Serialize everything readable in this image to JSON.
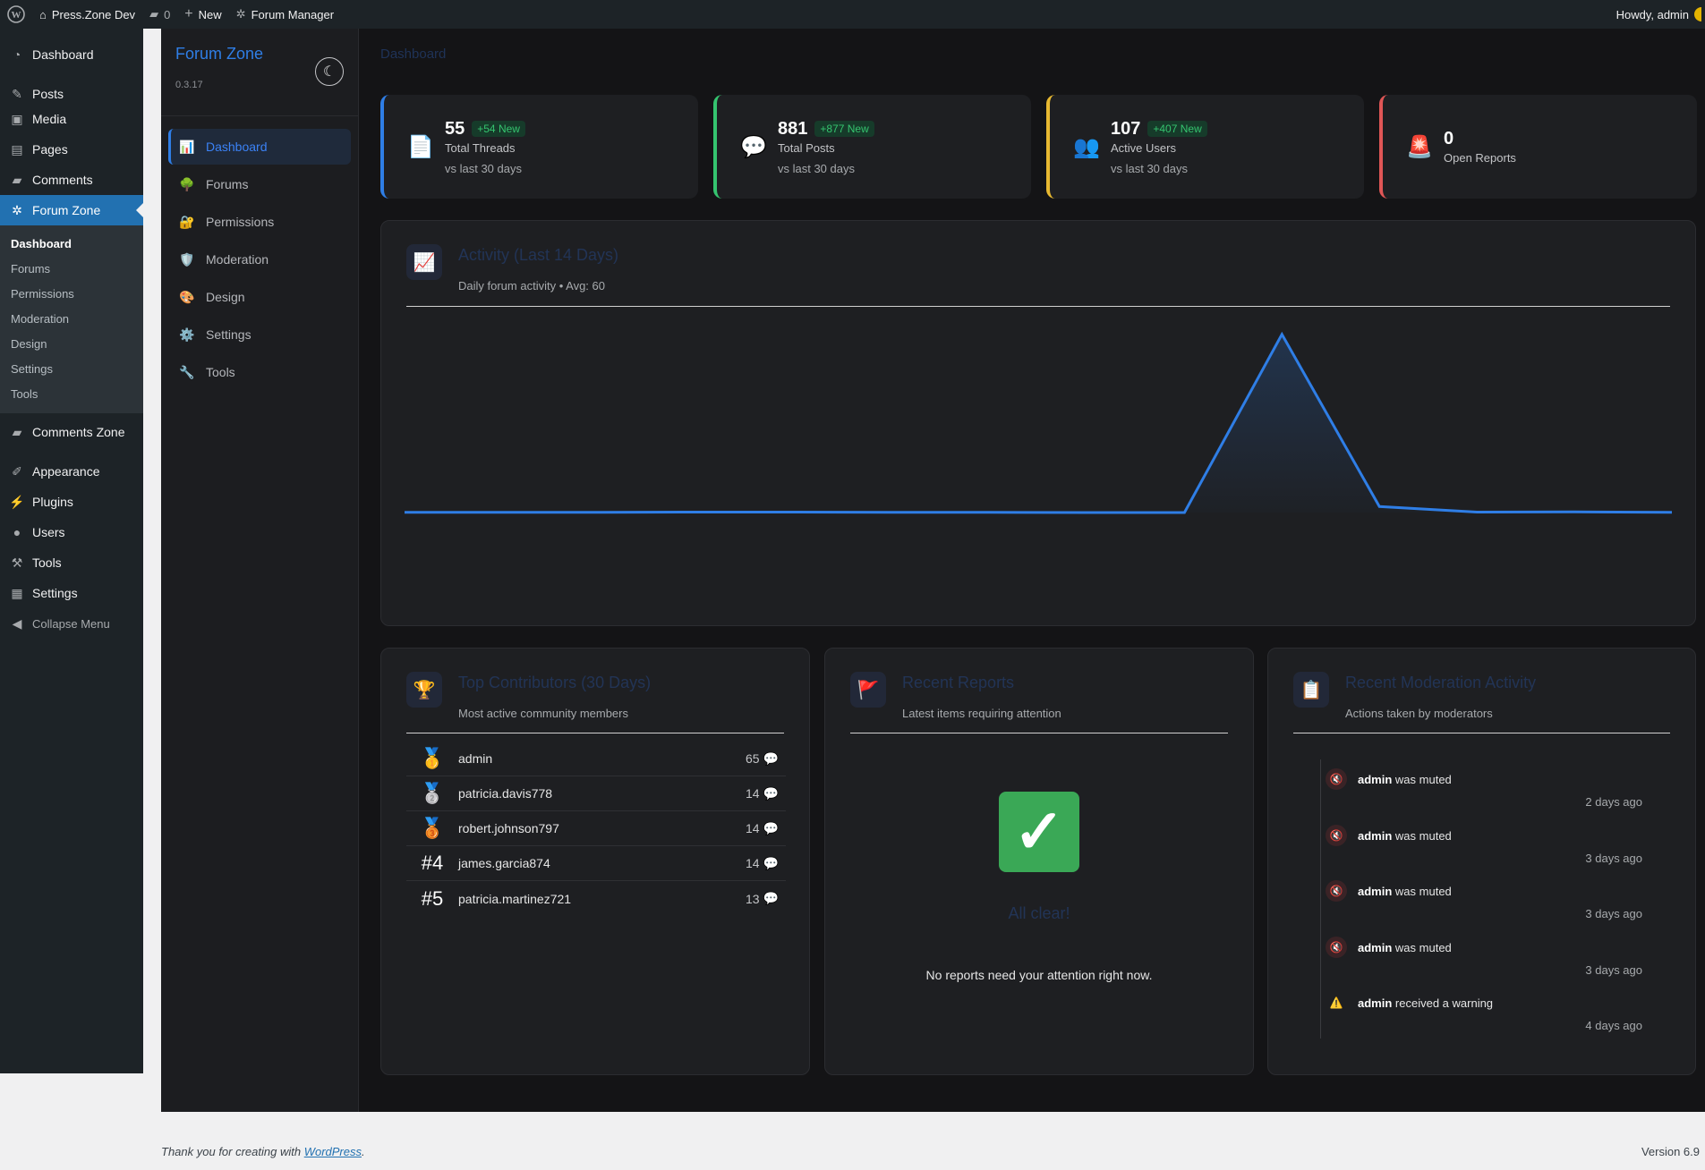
{
  "adminbar": {
    "site_name": "Press.Zone Dev",
    "comments_count": "0",
    "new_label": "New",
    "forum_manager_label": "Forum Manager",
    "howdy": "Howdy, admin"
  },
  "wp_menu": {
    "dashboard": "Dashboard",
    "posts": "Posts",
    "media": "Media",
    "pages": "Pages",
    "comments": "Comments",
    "forum_zone": "Forum Zone",
    "submenu": [
      "Dashboard",
      "Forums",
      "Permissions",
      "Moderation",
      "Design",
      "Settings",
      "Tools"
    ],
    "comments_zone": "Comments Zone",
    "appearance": "Appearance",
    "plugins": "Plugins",
    "users": "Users",
    "tools": "Tools",
    "settings": "Settings",
    "collapse": "Collapse Menu"
  },
  "plugin": {
    "title": "Forum Zone",
    "version": "0.3.17",
    "nav": [
      {
        "label": "Dashboard",
        "icon": "📊"
      },
      {
        "label": "Forums",
        "icon": "🌳"
      },
      {
        "label": "Permissions",
        "icon": "🔐"
      },
      {
        "label": "Moderation",
        "icon": "🛡️"
      },
      {
        "label": "Design",
        "icon": "🎨"
      },
      {
        "label": "Settings",
        "icon": "⚙️"
      },
      {
        "label": "Tools",
        "icon": "🔧"
      }
    ]
  },
  "page_title": "Dashboard",
  "stats": [
    {
      "value": "55",
      "badge": "+54 New",
      "label": "Total Threads",
      "sub": "vs last 30 days",
      "icon": "📄",
      "color": "#2f7ee6"
    },
    {
      "value": "881",
      "badge": "+877 New",
      "label": "Total Posts",
      "sub": "vs last 30 days",
      "icon": "💬",
      "color": "#35c46f"
    },
    {
      "value": "107",
      "badge": "+407 New",
      "label": "Active Users",
      "sub": "vs last 30 days",
      "icon": "👥",
      "color": "#e8b931"
    },
    {
      "value": "0",
      "badge": "",
      "label": "Open Reports",
      "sub": "",
      "icon": "🚨",
      "color": "#e05656"
    }
  ],
  "activity": {
    "title": "Activity (Last 14 Days)",
    "subtitle": "Daily forum activity • Avg: 60",
    "icon": "📈"
  },
  "chart_data": {
    "type": "area",
    "title": "Activity (Last 14 Days)",
    "xlabel": "",
    "ylabel": "",
    "x": [
      1,
      2,
      3,
      4,
      5,
      6,
      7,
      8,
      9,
      10,
      11,
      12,
      13,
      14
    ],
    "values": [
      1,
      1,
      1,
      2,
      2,
      1,
      1,
      0,
      0,
      805,
      27,
      2,
      3,
      1
    ],
    "ylim": [
      0,
      800
    ],
    "grid": false,
    "line_color": "#2f7ee6"
  },
  "contributors": {
    "title": "Top Contributors (30 Days)",
    "subtitle": "Most active community members",
    "icon": "🏆",
    "rows": [
      {
        "rank": "🥇",
        "name": "admin",
        "count": "65"
      },
      {
        "rank": "🥈",
        "name": "patricia.davis778",
        "count": "14"
      },
      {
        "rank": "🥉",
        "name": "robert.johnson797",
        "count": "14"
      },
      {
        "rank": "#4",
        "name": "james.garcia874",
        "count": "14"
      },
      {
        "rank": "#5",
        "name": "patricia.martinez721",
        "count": "13"
      }
    ]
  },
  "reports": {
    "title": "Recent Reports",
    "subtitle": "Latest items requiring attention",
    "icon": "🚩",
    "empty_title": "All clear!",
    "empty_text": "No reports need your attention right now."
  },
  "moderation": {
    "title": "Recent Moderation Activity",
    "subtitle": "Actions taken by moderators",
    "icon": "📋",
    "items": [
      {
        "user": "admin",
        "action": "was muted",
        "time": "2 days ago",
        "icon": "🔇"
      },
      {
        "user": "admin",
        "action": "was muted",
        "time": "3 days ago",
        "icon": "🔇"
      },
      {
        "user": "admin",
        "action": "was muted",
        "time": "3 days ago",
        "icon": "🔇"
      },
      {
        "user": "admin",
        "action": "was muted",
        "time": "3 days ago",
        "icon": "🔇"
      },
      {
        "user": "admin",
        "action": "received a warning",
        "time": "4 days ago",
        "icon": "⚠️"
      }
    ]
  },
  "footer": {
    "thanks_prefix": "Thank you for creating with ",
    "wordpress": "WordPress",
    "thanks_suffix": ".",
    "version": "Version 6.9"
  }
}
